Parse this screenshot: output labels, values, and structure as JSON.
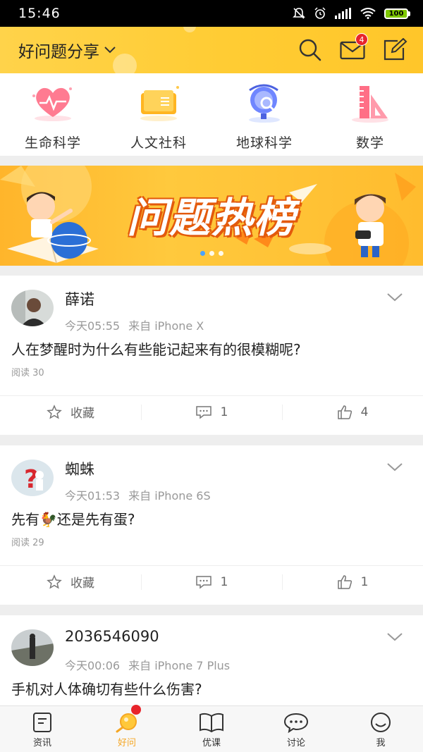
{
  "status_bar": {
    "time": "15:46",
    "battery": "100"
  },
  "header": {
    "title": "好问题分享",
    "mail_badge": "4"
  },
  "categories": [
    {
      "label": "生命科学",
      "icon": "heart-icon"
    },
    {
      "label": "人文社科",
      "icon": "book-icon"
    },
    {
      "label": "地球科学",
      "icon": "globe-icon"
    },
    {
      "label": "数学",
      "icon": "ruler-triangle-icon"
    }
  ],
  "banner": {
    "title": "问题热榜"
  },
  "posts": [
    {
      "user": "薛诺",
      "time": "今天05:55",
      "source": "来自 iPhone X",
      "question": "人在梦醒时为什么有些能记起来有的很模糊呢?",
      "reads": "阅读 30",
      "favorite_label": "收藏",
      "comments": "1",
      "likes": "4"
    },
    {
      "user": "蜘蛛",
      "time": "今天01:53",
      "source": "来自 iPhone 6S",
      "question": "先有🐓还是先有蛋?",
      "reads": "阅读 29",
      "favorite_label": "收藏",
      "comments": "1",
      "likes": "1"
    },
    {
      "user": "2036546090",
      "time": "今天00:06",
      "source": "来自 iPhone 7 Plus",
      "question": "手机对人体确切有些什么伤害?"
    }
  ],
  "tabs": [
    {
      "label": "资讯",
      "icon": "news-icon"
    },
    {
      "label": "好问",
      "icon": "ask-icon"
    },
    {
      "label": "优课",
      "icon": "open-book-icon"
    },
    {
      "label": "讨论",
      "icon": "chat-bubble-icon"
    },
    {
      "label": "我",
      "icon": "smiley-icon"
    }
  ],
  "colors": {
    "accent": "#ffcc33",
    "active_tab": "#f5a623",
    "badge": "#e8242b"
  }
}
